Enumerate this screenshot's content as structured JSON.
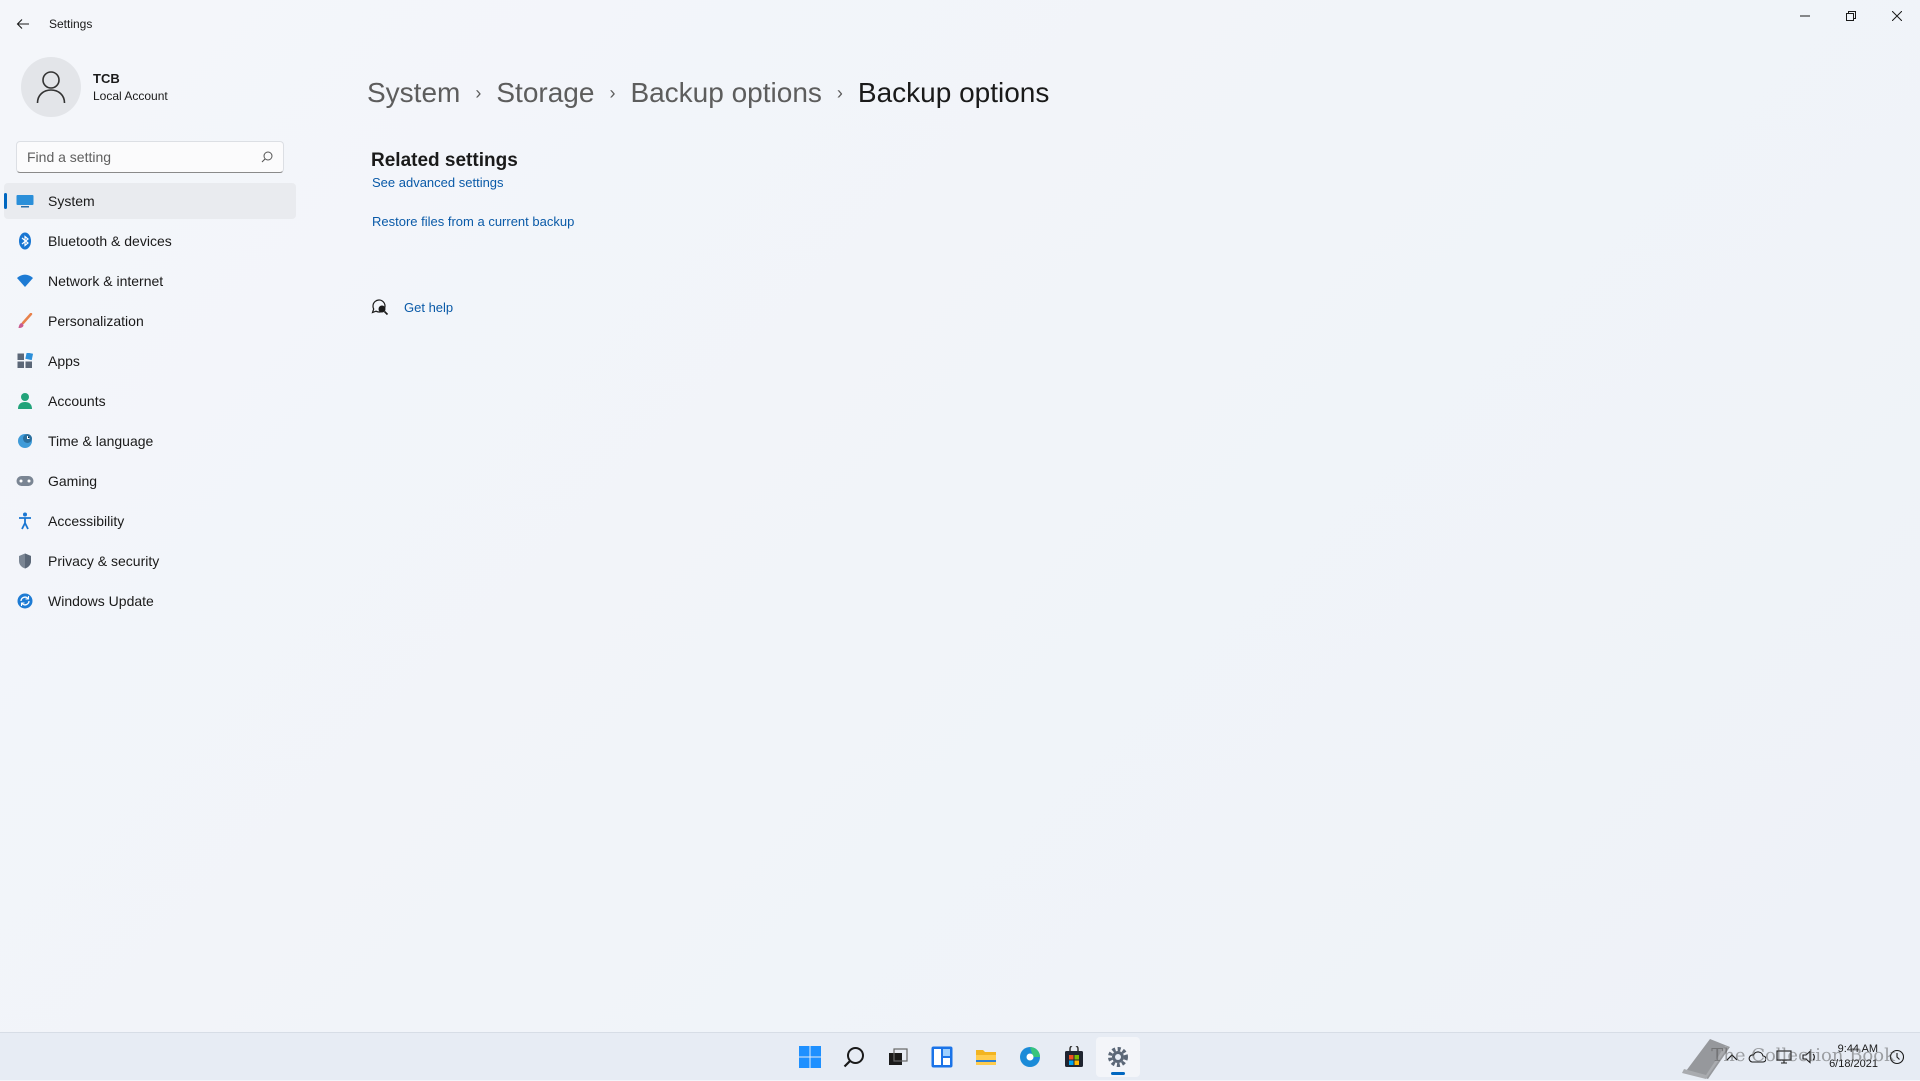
{
  "window": {
    "title": "Settings"
  },
  "profile": {
    "name": "TCB",
    "subtitle": "Local Account"
  },
  "search": {
    "placeholder": "Find a setting"
  },
  "sidebar": {
    "items": [
      {
        "label": "System",
        "icon": "monitor-icon",
        "active": true
      },
      {
        "label": "Bluetooth & devices",
        "icon": "bluetooth-icon"
      },
      {
        "label": "Network & internet",
        "icon": "wifi-icon"
      },
      {
        "label": "Personalization",
        "icon": "paintbrush-icon"
      },
      {
        "label": "Apps",
        "icon": "apps-icon"
      },
      {
        "label": "Accounts",
        "icon": "person-icon"
      },
      {
        "label": "Time & language",
        "icon": "globe-clock-icon"
      },
      {
        "label": "Gaming",
        "icon": "gamepad-icon"
      },
      {
        "label": "Accessibility",
        "icon": "accessibility-icon"
      },
      {
        "label": "Privacy & security",
        "icon": "shield-icon"
      },
      {
        "label": "Windows Update",
        "icon": "refresh-icon"
      }
    ]
  },
  "breadcrumb": {
    "items": [
      "System",
      "Storage",
      "Backup options",
      "Backup options"
    ]
  },
  "related": {
    "title": "Related settings",
    "advanced_link": "See advanced settings",
    "restore_link": "Restore files from a current backup"
  },
  "help": {
    "label": "Get help"
  },
  "taskbar": {
    "apps": [
      "start-icon",
      "search-icon",
      "task-view-icon",
      "widgets-icon",
      "file-explorer-icon",
      "edge-icon",
      "store-icon",
      "settings-icon"
    ],
    "active_app": "settings-icon"
  },
  "tray": {
    "time": "9:44 AM",
    "date": "6/18/2021",
    "watermark": "The Collection Book"
  },
  "colors": {
    "accent": "#0067c0",
    "link": "#0a5aa8"
  }
}
